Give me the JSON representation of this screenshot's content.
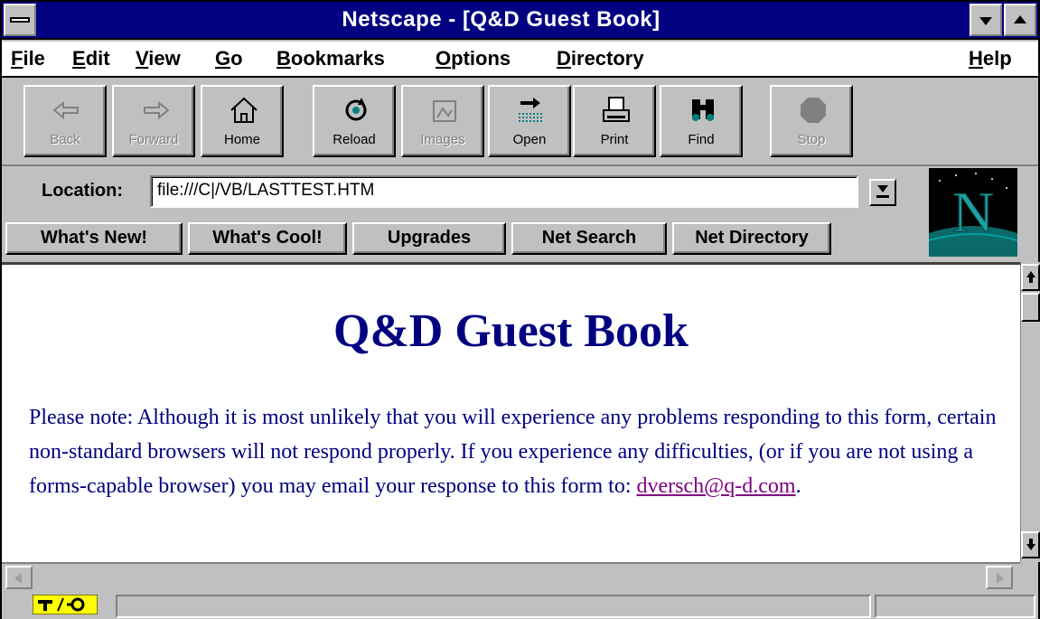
{
  "window": {
    "title": "Netscape - [Q&D Guest Book]"
  },
  "menubar": {
    "items": [
      "File",
      "Edit",
      "View",
      "Go",
      "Bookmarks",
      "Options",
      "Directory",
      "Help"
    ]
  },
  "toolbar": {
    "buttons": [
      {
        "label": "Back",
        "icon": "back-arrow-icon",
        "enabled": false
      },
      {
        "label": "Forward",
        "icon": "forward-arrow-icon",
        "enabled": false
      },
      {
        "label": "Home",
        "icon": "home-icon",
        "enabled": true
      },
      {
        "label": "Reload",
        "icon": "reload-icon",
        "enabled": true
      },
      {
        "label": "Images",
        "icon": "images-icon",
        "enabled": false
      },
      {
        "label": "Open",
        "icon": "open-icon",
        "enabled": true
      },
      {
        "label": "Print",
        "icon": "print-icon",
        "enabled": true
      },
      {
        "label": "Find",
        "icon": "binoculars-icon",
        "enabled": true
      },
      {
        "label": "Stop",
        "icon": "stop-icon",
        "enabled": false
      }
    ]
  },
  "location": {
    "label": "Location:",
    "url": "file:///C|/VB/LASTTEST.HTM"
  },
  "directory_buttons": [
    "What's New!",
    "What's Cool!",
    "Upgrades",
    "Net Search",
    "Net Directory"
  ],
  "logo": {
    "letter": "N"
  },
  "page": {
    "title": "Q&D Guest Book",
    "body_text": "Please note: Although it is most unlikely that you will experience any problems responding to this form, certain non-standard browsers will not respond properly. If you experience any difficulties, (or if you are not using a forms-capable browser) you may email your response to this form to: ",
    "email": "dversch@q-d.com",
    "trailing": "."
  },
  "colors": {
    "title_bar": "#000080",
    "page_text": "#000080",
    "link_visited": "#800080",
    "chrome": "#c0c0c0"
  }
}
